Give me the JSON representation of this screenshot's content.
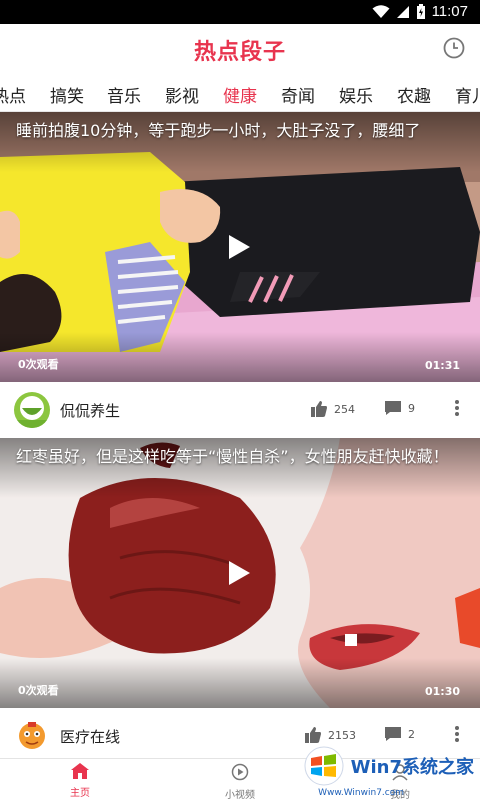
{
  "status_bar": {
    "time": "11:07"
  },
  "app": {
    "logo": "热点段子"
  },
  "tabs": [
    {
      "label": "热点",
      "active": false
    },
    {
      "label": "搞笑",
      "active": false
    },
    {
      "label": "音乐",
      "active": false
    },
    {
      "label": "影视",
      "active": false
    },
    {
      "label": "健康",
      "active": true
    },
    {
      "label": "奇闻",
      "active": false
    },
    {
      "label": "娱乐",
      "active": false
    },
    {
      "label": "农趣",
      "active": false
    },
    {
      "label": "育儿",
      "active": false
    }
  ],
  "videos": [
    {
      "title": "睡前拍腹10分钟，等于跑步一小时，大肚子没了，腰细了",
      "views": "0次观看",
      "duration": "01:31",
      "author": "侃侃养生",
      "likes": "254",
      "comments": "9"
    },
    {
      "title": "红枣虽好，但是这样吃等于“慢性自杀”，女性朋友赶快收藏！",
      "views": "0次观看",
      "duration": "01:30",
      "author": "医疗在线",
      "likes": "2153",
      "comments": "2"
    }
  ],
  "bottom_nav": [
    {
      "label": "主页",
      "icon": "home-icon",
      "active": true
    },
    {
      "label": "小视频",
      "icon": "play-circle-icon",
      "active": false
    },
    {
      "label": "我的",
      "icon": "person-icon",
      "active": false
    }
  ],
  "watermark": {
    "text": "Win7系统之家",
    "url": "Www.Winwin7.com"
  },
  "colors": {
    "accent": "#e8344e",
    "text": "#222222",
    "muted": "#777777"
  }
}
